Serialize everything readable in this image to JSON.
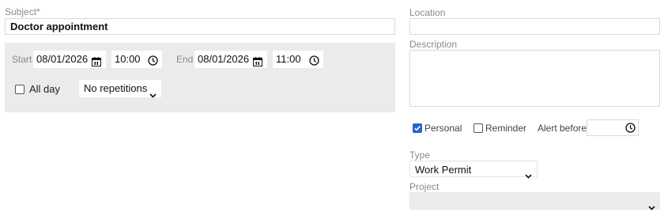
{
  "subject": {
    "label": "Subject*",
    "value": "Doctor appointment"
  },
  "start": {
    "label": "Start",
    "date": "08/01/2026",
    "time": "10:00"
  },
  "end": {
    "label": "End",
    "date": "08/01/2026",
    "time": "11:00"
  },
  "all_day": {
    "label": "All day",
    "checked": false
  },
  "repetitions": {
    "value": "No repetitions"
  },
  "location": {
    "label": "Location",
    "value": ""
  },
  "description": {
    "label": "Description",
    "value": ""
  },
  "personal": {
    "label": "Personal",
    "checked": true
  },
  "reminder": {
    "label": "Reminder",
    "checked": false
  },
  "alert": {
    "label": "Alert before",
    "value": ""
  },
  "type": {
    "label": "Type",
    "value": "Work Permit"
  },
  "project": {
    "label": "Project",
    "value": ""
  },
  "colors": {
    "accent": "#2266cc",
    "panel": "#ebebeb",
    "border": "#d9d9d9"
  },
  "icons": {
    "calendar": "calendar-icon",
    "clock": "clock-icon",
    "chevron": "chevron-down-icon",
    "check": "check-icon"
  }
}
